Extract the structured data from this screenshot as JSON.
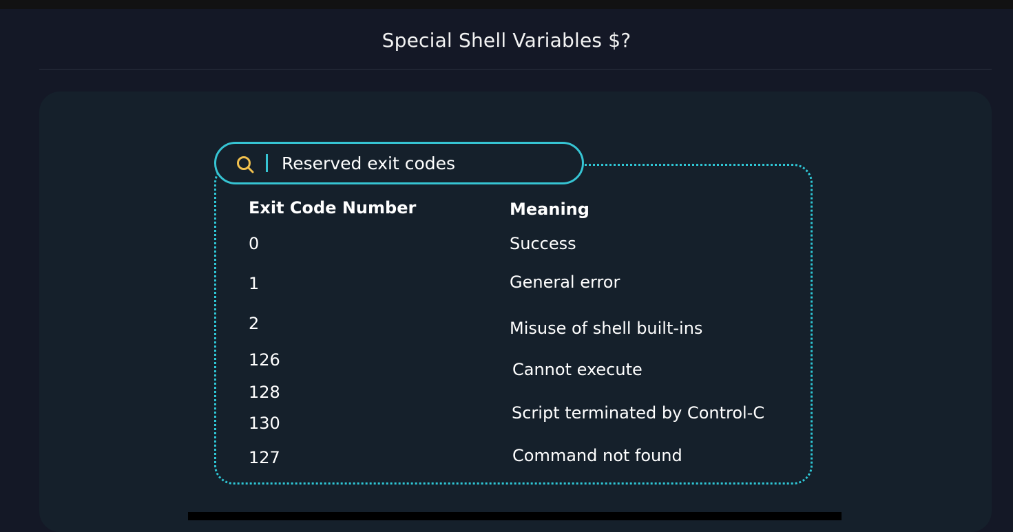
{
  "page": {
    "title": "Special Shell Variables $?"
  },
  "search": {
    "value": "Reserved exit codes",
    "icon": "search-icon"
  },
  "table": {
    "headers": [
      "Exit Code Number",
      "Meaning"
    ],
    "codes": [
      "0",
      "1",
      "2",
      "126",
      "128",
      "130",
      "127"
    ],
    "meanings": [
      "Success",
      "General error",
      "Misuse of shell built-ins",
      "Cannot execute",
      "Script terminated by Control-C",
      "Command not found"
    ]
  },
  "colors": {
    "background": "#141826",
    "panel": "#15202b",
    "accent_cyan": "#36c4d3",
    "search_icon": "#f2c14e"
  }
}
